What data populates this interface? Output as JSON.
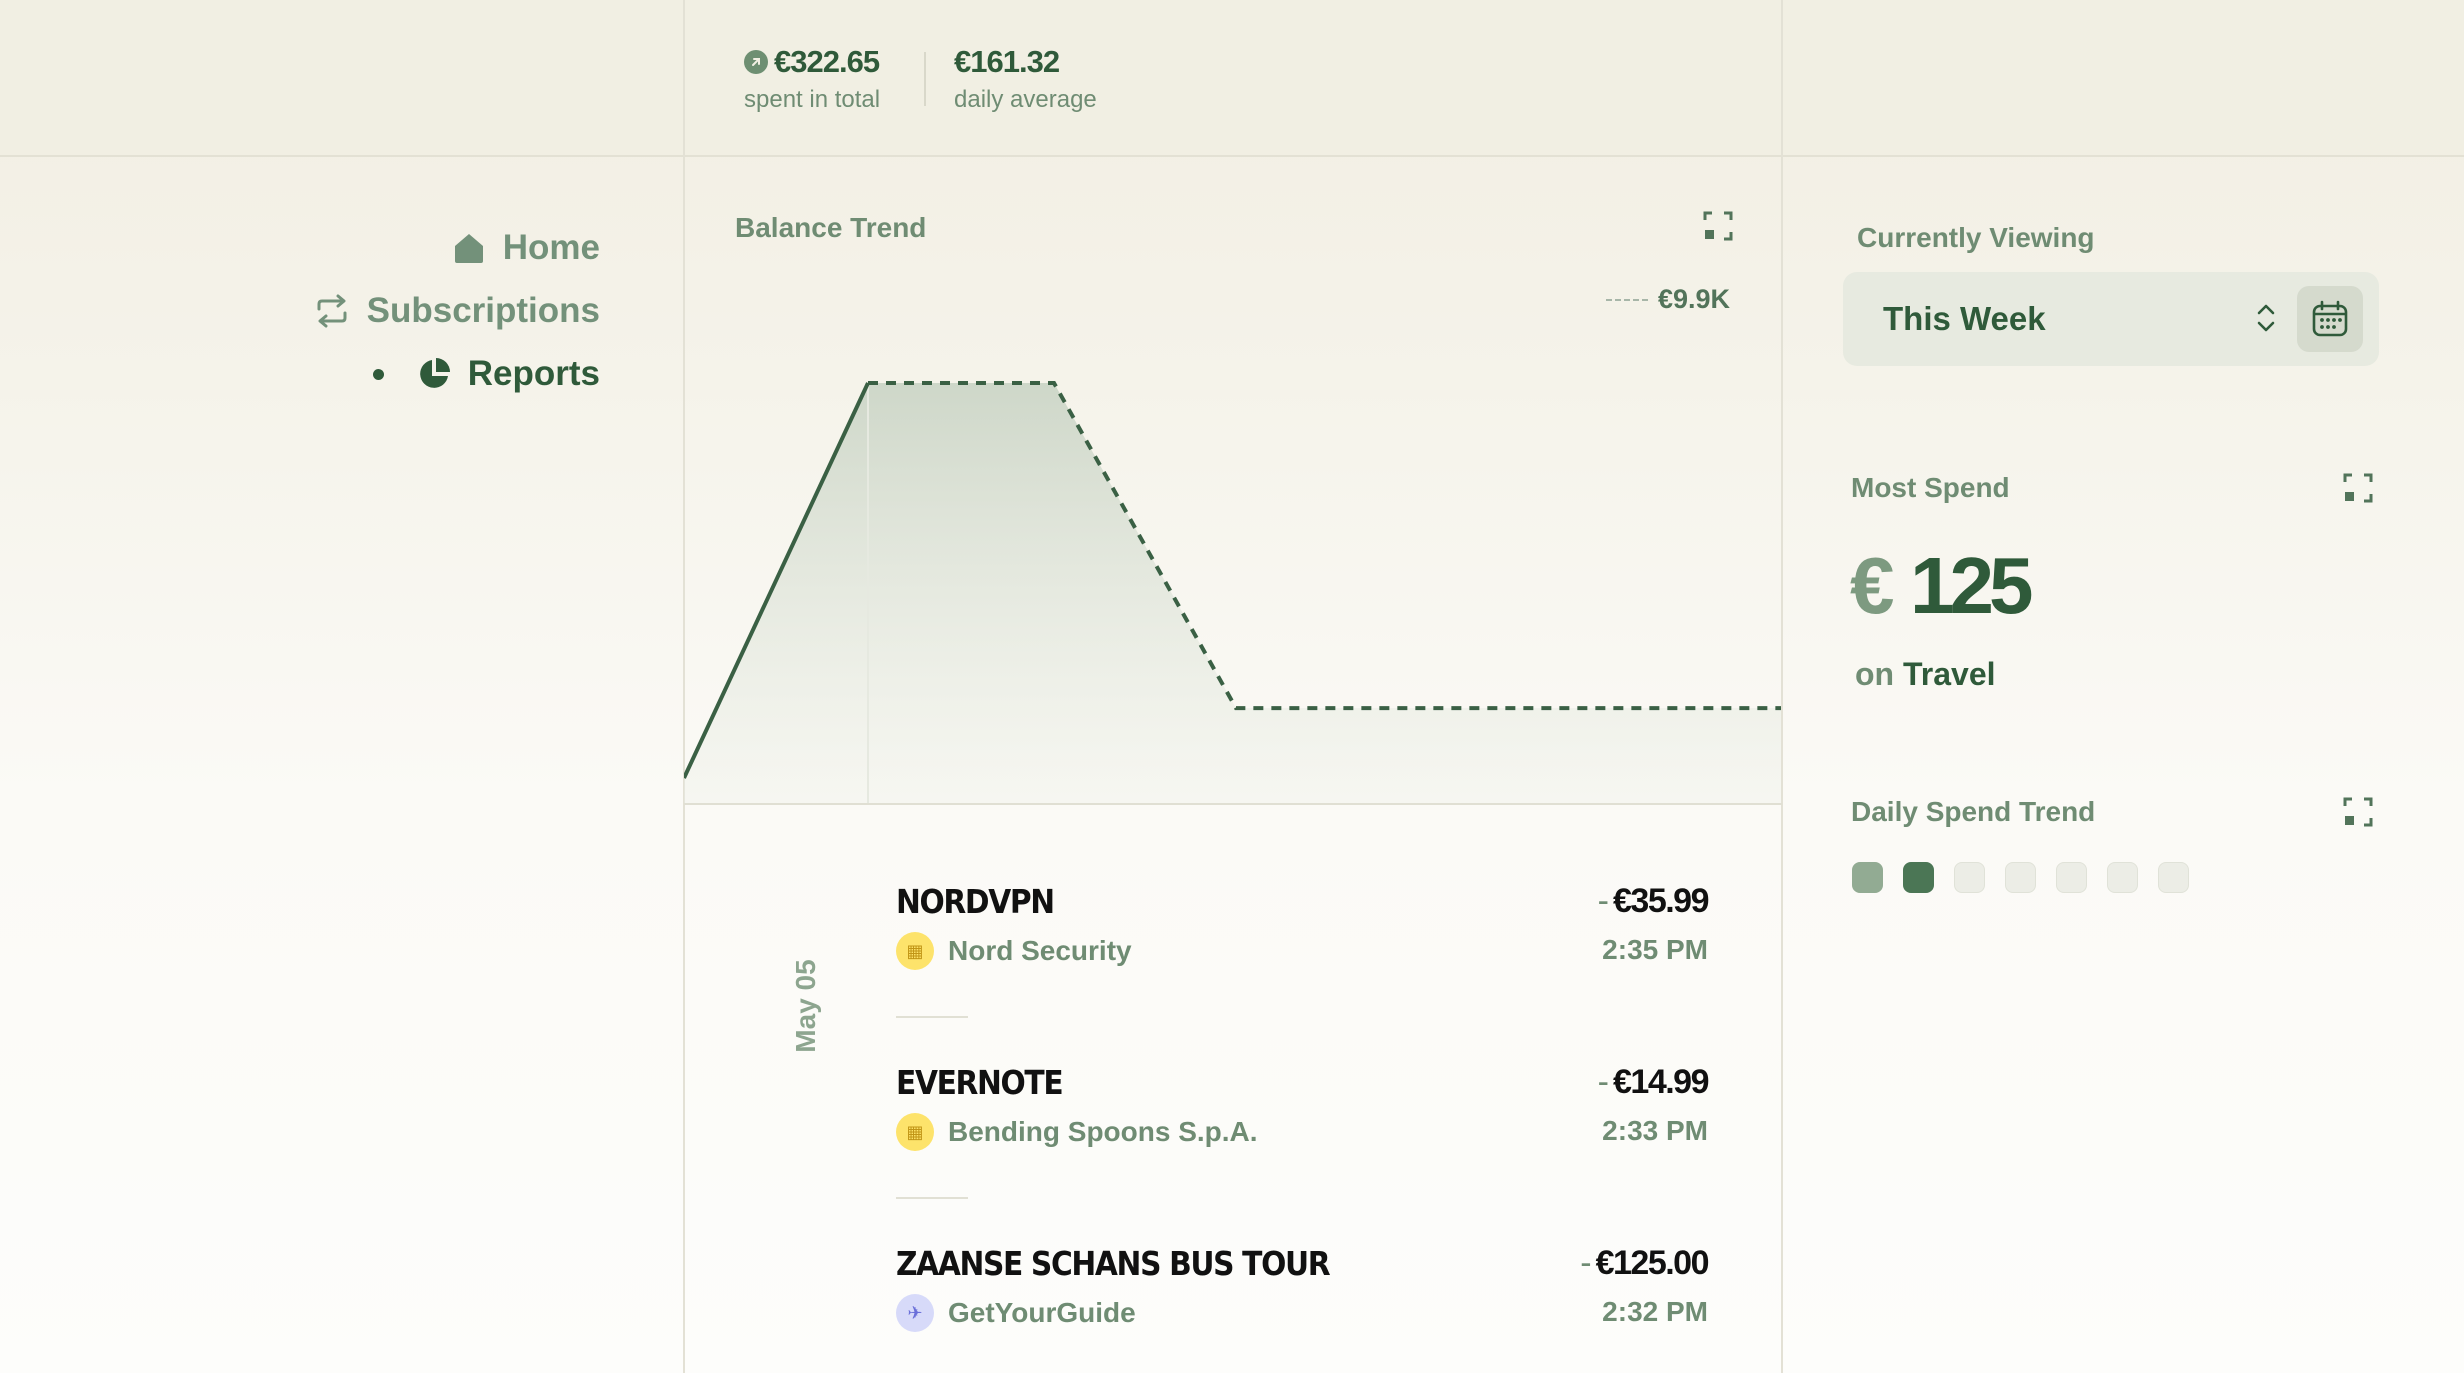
{
  "summary": {
    "total_value": "€322.65",
    "total_label": "spent in total",
    "average_value": "€161.32",
    "average_label": "daily average"
  },
  "nav": {
    "items": [
      {
        "label": "Home",
        "icon": "home-icon",
        "active": false
      },
      {
        "label": "Subscriptions",
        "icon": "repeat-icon",
        "active": false
      },
      {
        "label": "Reports",
        "icon": "pie-chart-icon",
        "active": true
      }
    ]
  },
  "balance_trend": {
    "title": "Balance Trend",
    "max_label": "€9.9K"
  },
  "chart_data": {
    "type": "area",
    "title": "Balance Trend",
    "x": [
      0,
      1,
      2,
      3,
      4,
      5,
      6
    ],
    "series": [
      {
        "values": [
          0,
          9900,
          9900,
          1750,
          1750,
          1750,
          1750
        ]
      }
    ],
    "ylabel": "",
    "xlabel": "",
    "max_marker": "€9.9K",
    "solid_through_index": 1,
    "grid": false
  },
  "transactions": {
    "date": "May 05",
    "items": [
      {
        "name": "NORDVPN",
        "amount_sign": "-",
        "amount": "€35.99",
        "merchant": "Nord Security",
        "time": "2:35 PM",
        "logo": "yellow-badge-icon"
      },
      {
        "name": "EVERNOTE",
        "amount_sign": "-",
        "amount": "€14.99",
        "merchant": "Bending Spoons S.p.A.",
        "time": "2:33 PM",
        "logo": "yellow-badge-icon"
      },
      {
        "name": "ZAANSE SCHANS BUS TOUR",
        "amount_sign": "-",
        "amount": "€125.00",
        "merchant": "GetYourGuide",
        "time": "2:32 PM",
        "logo": "plane-icon"
      }
    ]
  },
  "viewing": {
    "label": "Currently Viewing",
    "value": "This Week"
  },
  "most_spend": {
    "title": "Most Spend",
    "currency": "€",
    "amount": "125",
    "prefix": "on",
    "category": "Travel"
  },
  "daily_trend": {
    "title": "Daily Spend Trend",
    "levels": [
      "medium",
      "high",
      "none",
      "none",
      "none",
      "none",
      "none"
    ]
  },
  "colors": {
    "accent": "#2f5a3a",
    "muted": "#6f8c73",
    "background": "#f4f2e9"
  }
}
